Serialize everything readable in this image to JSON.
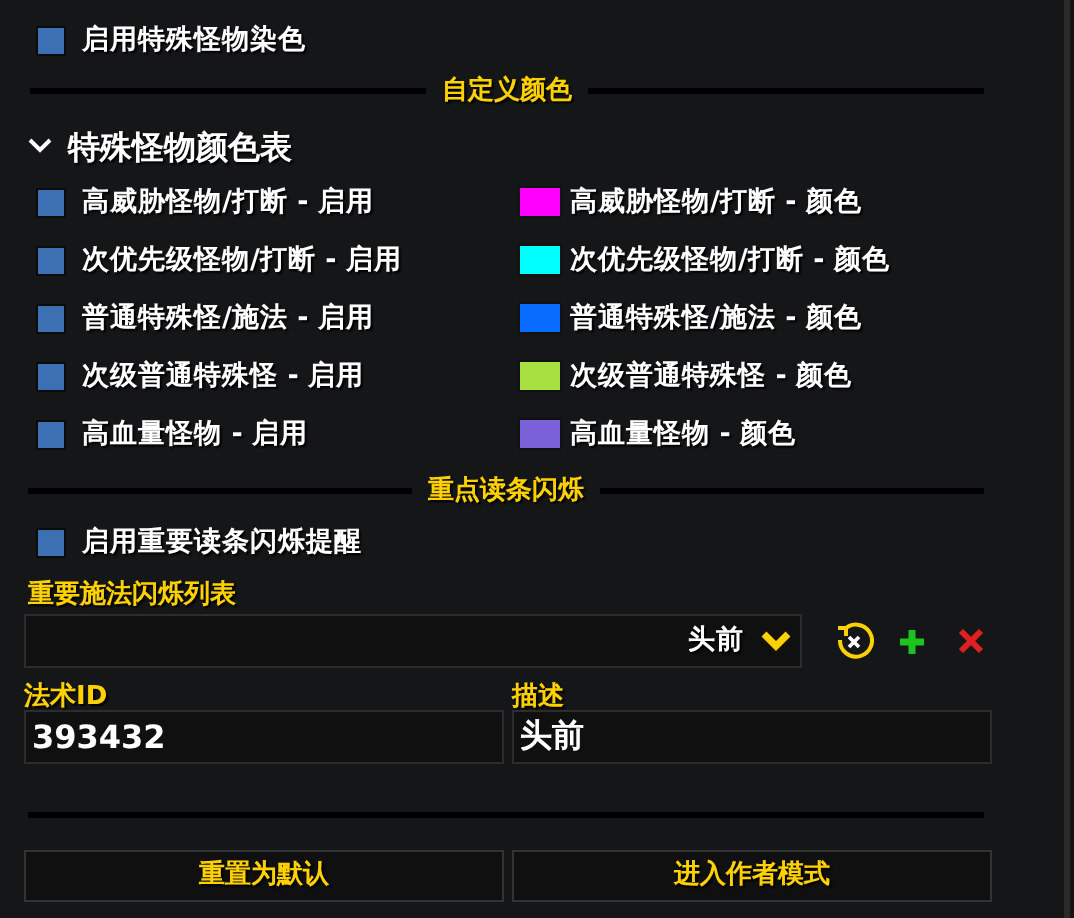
{
  "enable_coloring": {
    "label": "启用特殊怪物染色",
    "checked": false
  },
  "section_custom_colors": {
    "title": "自定义颜色"
  },
  "color_table": {
    "title": "特殊怪物颜色表",
    "expanded": true,
    "rows": [
      {
        "enable_label": "高威胁怪物/打断 - 启用",
        "checked": false,
        "color": "#ff00ff",
        "color_label": "高威胁怪物/打断 - 颜色"
      },
      {
        "enable_label": "次优先级怪物/打断 - 启用",
        "checked": false,
        "color": "#00ffff",
        "color_label": "次优先级怪物/打断 - 颜色"
      },
      {
        "enable_label": "普通特殊怪/施法 - 启用",
        "checked": false,
        "color": "#0a6cff",
        "color_label": "普通特殊怪/施法 - 颜色"
      },
      {
        "enable_label": "次级普通特殊怪 - 启用",
        "checked": false,
        "color": "#a8e040",
        "color_label": "次级普通特殊怪 - 颜色"
      },
      {
        "enable_label": "高血量怪物 - 启用",
        "checked": false,
        "color": "#7b62d8",
        "color_label": "高血量怪物 - 颜色"
      }
    ]
  },
  "section_cast_flash": {
    "title": "重点读条闪烁"
  },
  "enable_flash": {
    "label": "启用重要读条闪烁提醒",
    "checked": false
  },
  "flash_list": {
    "label": "重要施法闪烁列表",
    "value": "头前"
  },
  "spell_id": {
    "label": "法术ID",
    "value": "393432"
  },
  "description": {
    "label": "描述",
    "value": "头前"
  },
  "buttons": [
    "重置为默认",
    "进入作者模式"
  ]
}
